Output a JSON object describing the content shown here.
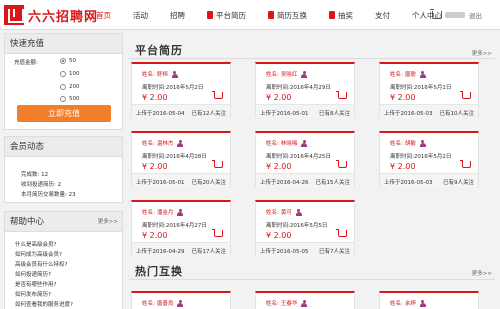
{
  "header": {
    "logo_text": "六六招聘网",
    "nav": [
      {
        "label": "首页",
        "active": true,
        "icon": false
      },
      {
        "label": "活动",
        "active": false,
        "icon": false
      },
      {
        "label": "招聘",
        "active": false,
        "icon": false
      },
      {
        "label": "平台简历",
        "active": false,
        "icon": true
      },
      {
        "label": "简历互换",
        "active": false,
        "icon": true
      },
      {
        "label": "抽奖",
        "active": false,
        "icon": true
      },
      {
        "label": "支付",
        "active": false,
        "icon": false
      },
      {
        "label": "个人中心",
        "active": false,
        "icon": false
      }
    ],
    "logout": "退出",
    "accent_color": "#d9161a"
  },
  "recharge": {
    "title": "快速充值",
    "amount_label": "充值金额:",
    "options": [
      "50",
      "100",
      "200",
      "500"
    ],
    "selected": "50",
    "button": "立即充值"
  },
  "member": {
    "title": "会员动态",
    "stats": [
      {
        "label": "完成数:",
        "value": "12"
      },
      {
        "label": "收到投递简历:",
        "value": "2"
      },
      {
        "label": "本月简历交易数量:",
        "value": "23"
      }
    ]
  },
  "help": {
    "title": "帮助中心",
    "more": "更多>>",
    "links": [
      "什么是高级会员?",
      "如何成为高级会员?",
      "高级会员有什么特权?",
      "如何投递简历?",
      "是否有哪些作用?",
      "如何发布简历?",
      "如何查看我的服务进度?"
    ]
  },
  "main": {
    "resume_section": {
      "title": "平台简历",
      "more": "更多>>"
    },
    "hot_section": {
      "title": "热门互换",
      "more": "更多>>"
    },
    "name_label": "姓名:",
    "date_label": "离职时间:",
    "cards": [
      {
        "name": "舒桓",
        "date": "2016年5月2日",
        "price": "¥ 2.00",
        "upload": "上传于2016-05-04",
        "follow": "已有12人关注"
      },
      {
        "name": "吴晓红",
        "date": "2016年4月29日",
        "price": "¥ 2.00",
        "upload": "上传于2016-05-01",
        "follow": "已有8人关注"
      },
      {
        "name": "唐聪",
        "date": "2016年5月1日",
        "price": "¥ 2.00",
        "upload": "上传于2016-05-03",
        "follow": "已有10人关注"
      },
      {
        "name": "温林杰",
        "date": "2016年4月28日",
        "price": "¥ 2.00",
        "upload": "上传于2016-05-01",
        "follow": "已有20人关注"
      },
      {
        "name": "林晓梅",
        "date": "2016年4月25日",
        "price": "¥ 2.00",
        "upload": "上传于2016-04-26",
        "follow": "已有15人关注"
      },
      {
        "name": "胡敏",
        "date": "2016年5月2日",
        "price": "¥ 2.00",
        "upload": "上传于2016-05-03",
        "follow": "已有9人关注"
      },
      {
        "name": "潘金月",
        "date": "2016年4月27日",
        "price": "¥ 2.00",
        "upload": "上传于2016-04-29",
        "follow": "已有17人关注"
      },
      {
        "name": "黄可",
        "date": "2016年5月5日",
        "price": "¥ 2.00",
        "upload": "上传于2016-05-05",
        "follow": "已有7人关注"
      }
    ],
    "hot_cards": [
      {
        "name": "唐善良"
      },
      {
        "name": "王春华"
      },
      {
        "name": "余婷"
      }
    ]
  }
}
